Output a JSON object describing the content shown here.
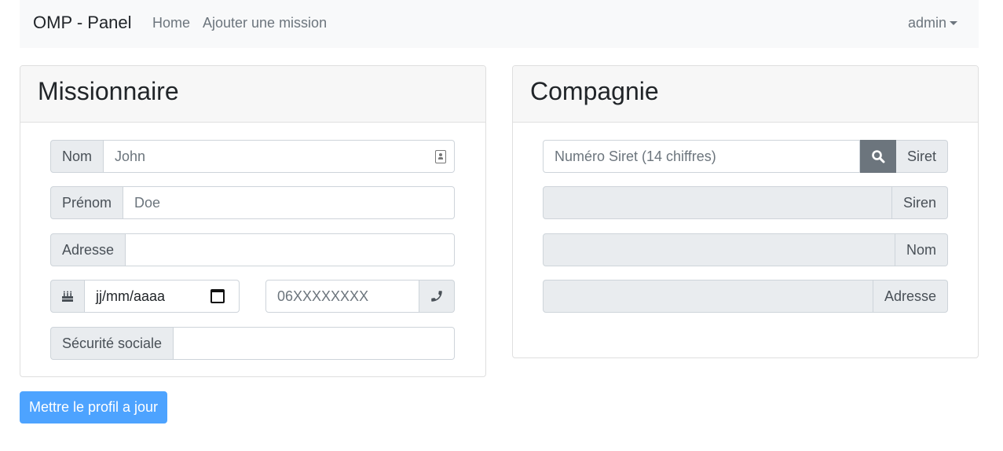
{
  "navbar": {
    "brand": "OMP - Panel",
    "links": [
      {
        "label": "Home"
      },
      {
        "label": "Ajouter une mission"
      }
    ],
    "user": "admin"
  },
  "missionnaire": {
    "title": "Missionnaire",
    "nom": {
      "label": "Nom",
      "placeholder": "John"
    },
    "prenom": {
      "label": "Prénom",
      "placeholder": "Doe"
    },
    "adresse": {
      "label": "Adresse",
      "value": ""
    },
    "birthdate": {
      "placeholder": "jj/mm/aaaa",
      "icon": "birthday-cake-icon"
    },
    "phone": {
      "placeholder": "06XXXXXXXX",
      "icon": "phone-icon"
    },
    "secu": {
      "label": "Sécurité sociale",
      "value": ""
    }
  },
  "compagnie": {
    "title": "Compagnie",
    "siret": {
      "placeholder": "Numéro Siret (14 chiffres)",
      "label": "Siret",
      "icon": "search-icon"
    },
    "siren": {
      "label": "Siren",
      "value": ""
    },
    "nom": {
      "label": "Nom",
      "value": ""
    },
    "adresse": {
      "label": "Adresse",
      "value": ""
    }
  },
  "actions": {
    "update_label": "Mettre le profil a jour"
  },
  "colors": {
    "primary": "#4da3ff",
    "secondary": "#6c757d",
    "addon_bg": "#e9ecef",
    "navbar_bg": "#f8f9fa"
  }
}
